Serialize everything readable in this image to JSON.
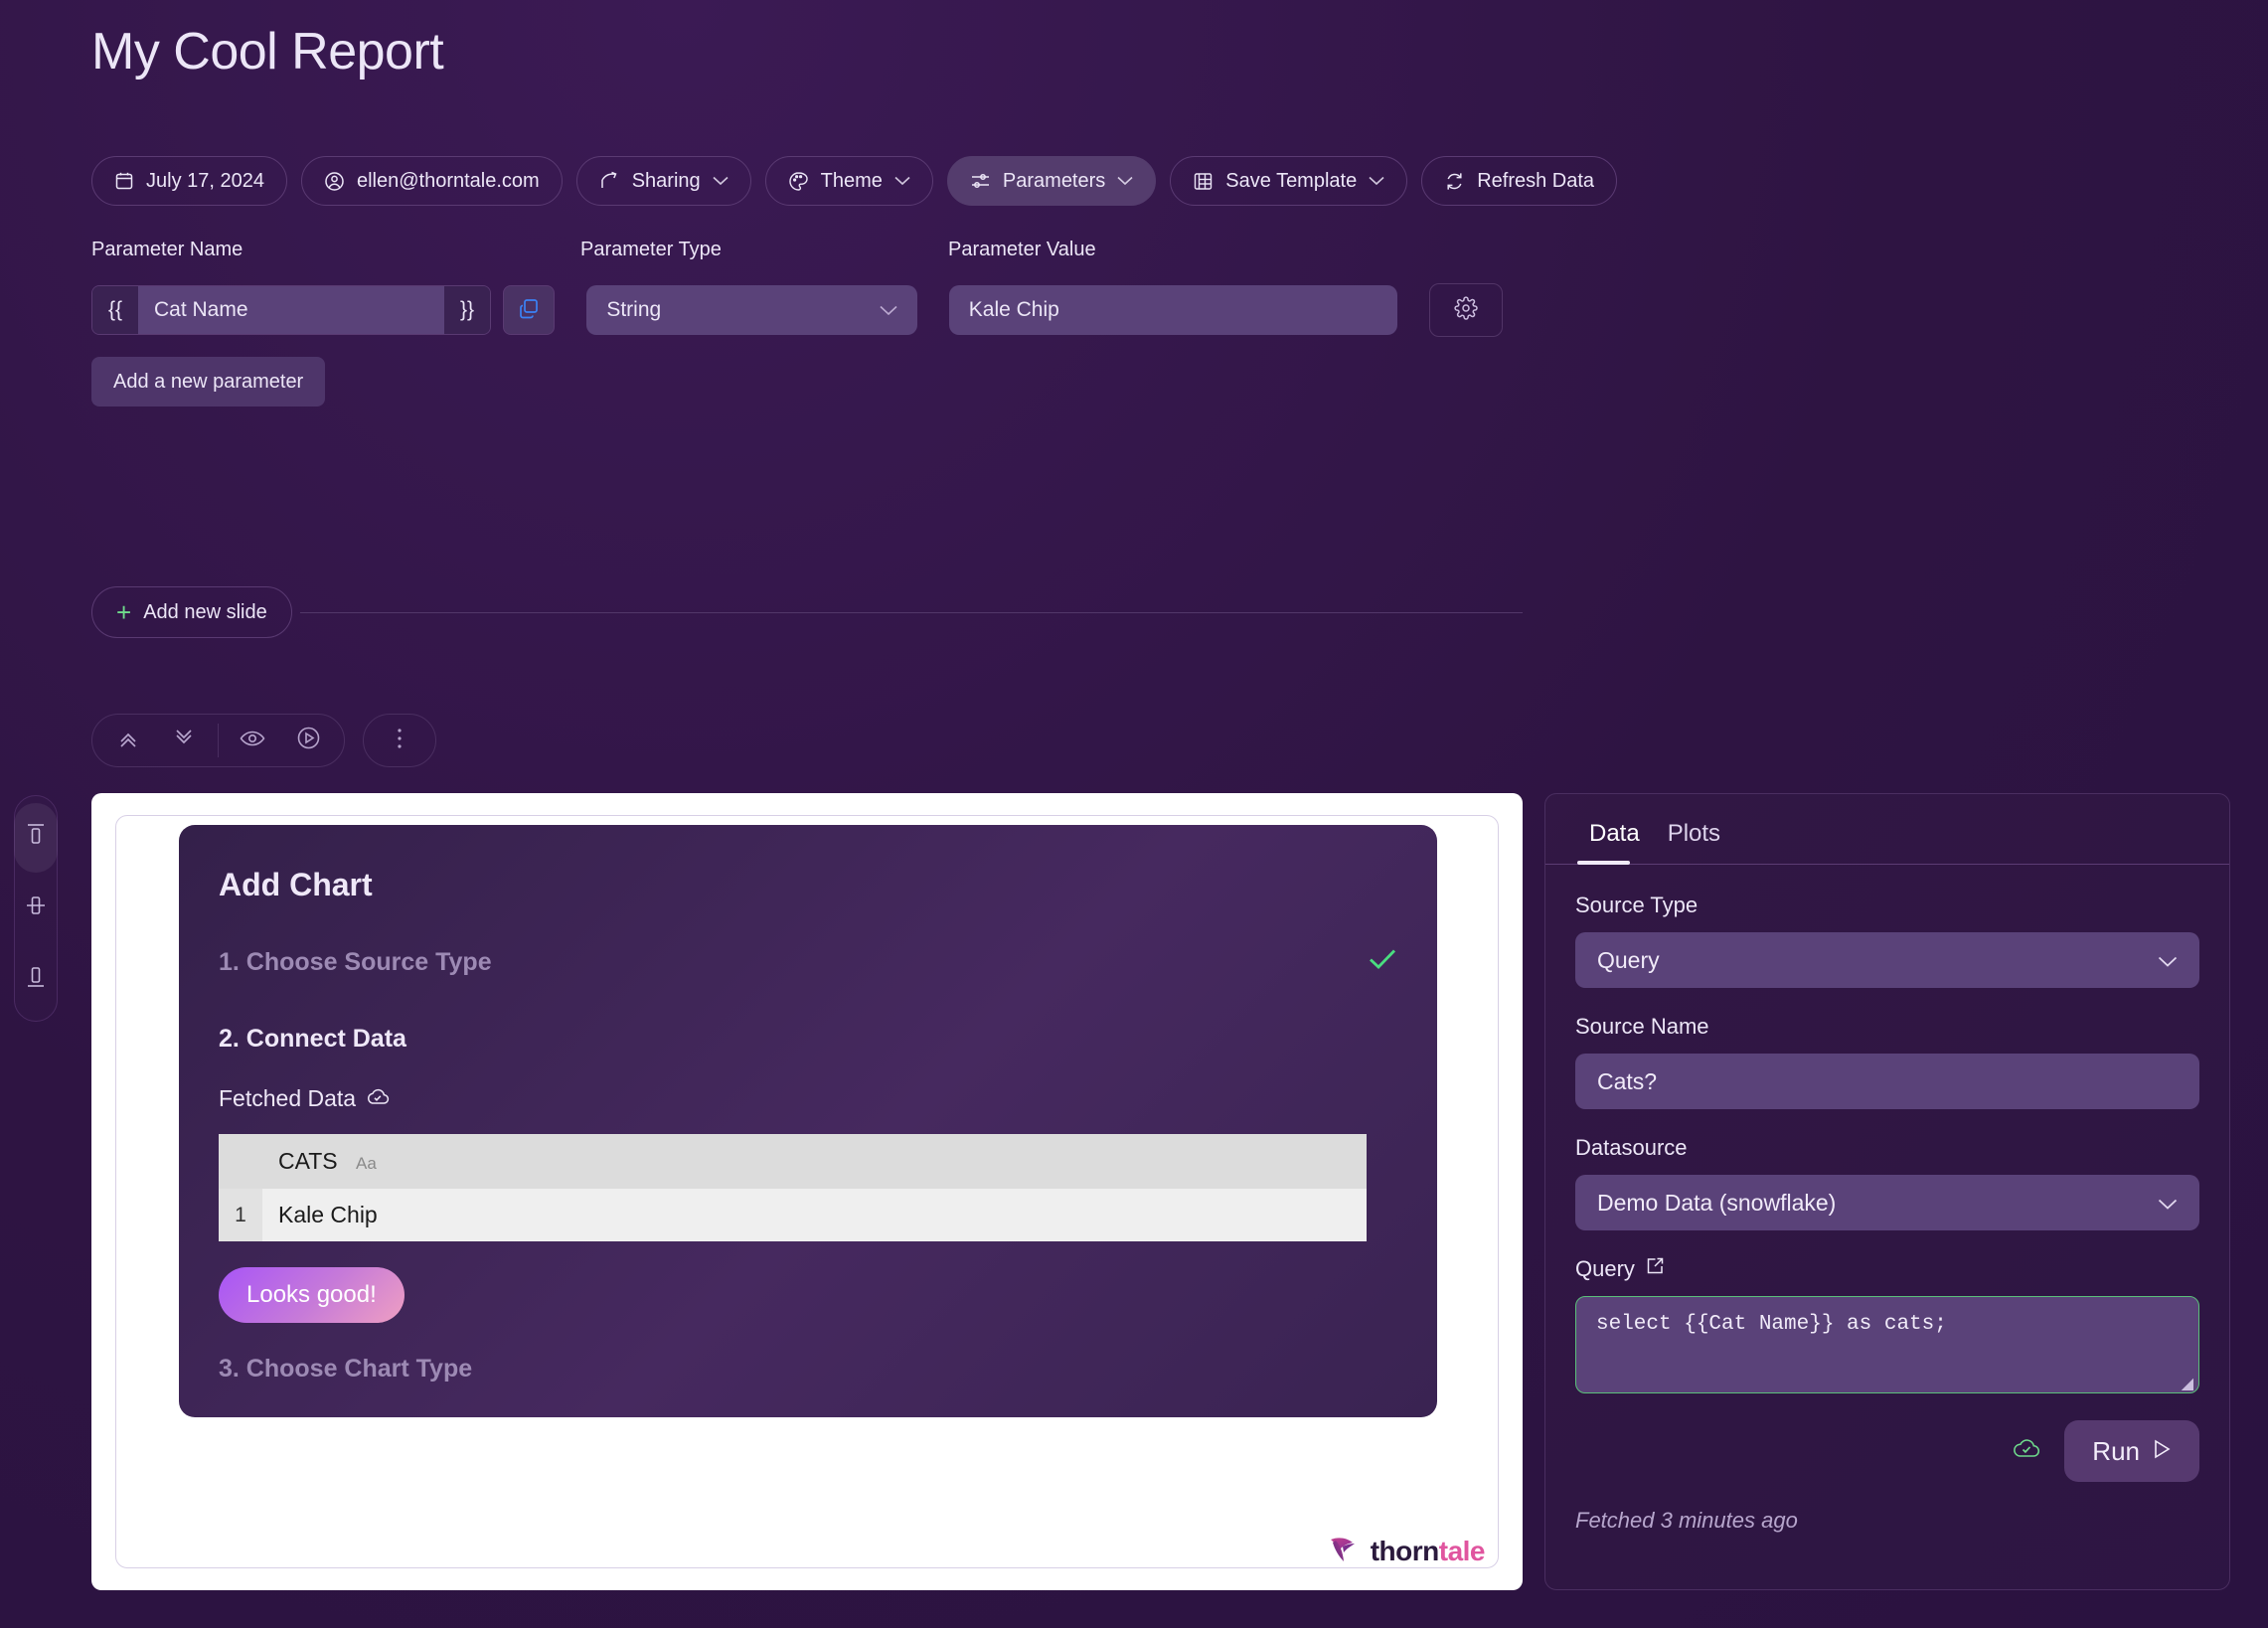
{
  "page": {
    "title": "My Cool Report",
    "accent_green": "#6fdc8c",
    "accent_pink": "#e0559f",
    "background": "#2e1442"
  },
  "toolbar": {
    "date": "July 17, 2024",
    "account": "ellen@thorntale.com",
    "sharing": "Sharing",
    "theme": "Theme",
    "parameters": "Parameters",
    "save_template": "Save Template",
    "refresh_data": "Refresh Data"
  },
  "parameters": {
    "headers": {
      "name": "Parameter Name",
      "type": "Parameter Type",
      "value": "Parameter Value"
    },
    "open_brace": "{{",
    "close_brace": "}}",
    "row": {
      "name_value": "Cat Name",
      "name_placeholder": "Parameter name",
      "type_value": "String",
      "value_value": "Kale Chip",
      "value_placeholder": "Value"
    },
    "add_button": "Add a new parameter"
  },
  "slide_bar": {
    "add_new_slide": "Add new slide"
  },
  "add_chart": {
    "title": "Add Chart",
    "step1": "1. Choose Source Type",
    "step2": "2. Connect Data",
    "step3": "3. Choose Chart Type",
    "fetched_data_label": "Fetched Data",
    "table": {
      "columns": [
        "CATS"
      ],
      "column_type_hint": "Aa",
      "rows": [
        {
          "num": "1",
          "cells": [
            "Kale Chip"
          ]
        }
      ]
    },
    "confirm_button": "Looks good!"
  },
  "brand": {
    "thorn": "thorn",
    "tale": "tale"
  },
  "right_panel": {
    "tabs": [
      {
        "label": "Data",
        "active": true
      },
      {
        "label": "Plots",
        "active": false
      }
    ],
    "source_type_label": "Source Type",
    "source_type_value": "Query",
    "source_name_label": "Source Name",
    "source_name_value": "Cats?",
    "source_name_placeholder": "Source name",
    "datasource_label": "Datasource",
    "datasource_value": "Demo Data (snowflake)",
    "query_label": "Query",
    "query_value": "select {{Cat Name}} as cats;",
    "run_button": "Run",
    "fetched_note": "Fetched 3 minutes ago"
  }
}
